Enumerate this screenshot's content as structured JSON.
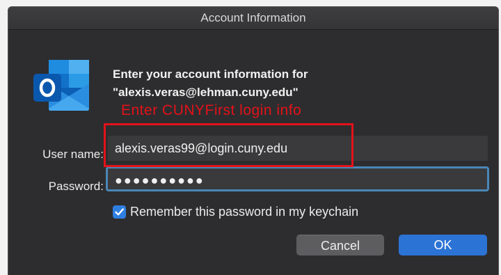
{
  "window": {
    "title": "Account Information"
  },
  "header": {
    "line1": "Enter your account information for",
    "line2": "\"alexis.veras@lehman.cuny.edu\""
  },
  "annotation": {
    "text": "Enter CUNYFirst login info",
    "color": "#e3121a"
  },
  "form": {
    "username_label": "User name:",
    "username_value": "alexis.veras99@login.cuny.edu",
    "password_label": "Password:",
    "password_value": "●●●●●●●●●●",
    "remember_checked": true,
    "remember_label": "Remember this password in my keychain"
  },
  "buttons": {
    "cancel": "Cancel",
    "ok": "OK"
  },
  "colors": {
    "accent": "#2c73d6",
    "focus_ring": "#4a87b8",
    "background": "#2d2d2f"
  },
  "icons": {
    "app": "outlook-icon",
    "check": "checkmark-icon"
  }
}
